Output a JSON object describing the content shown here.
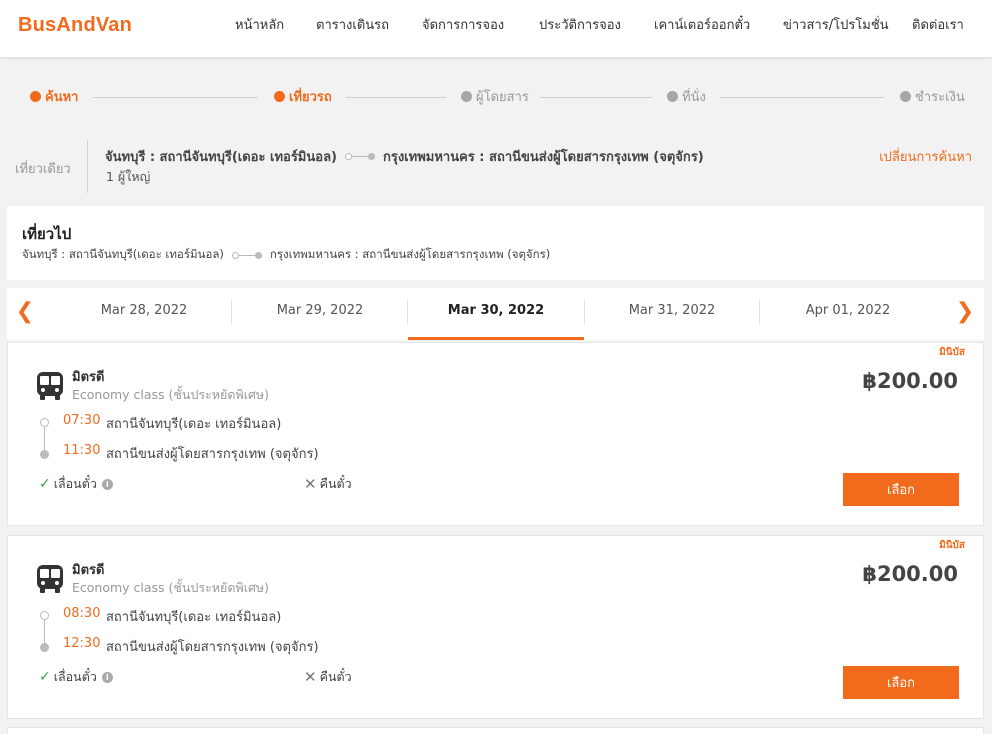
{
  "header": {
    "logo": "BusAndVan",
    "nav": [
      "หน้าหลัก",
      "ตารางเดินรถ",
      "จัดการการจอง",
      "ประวัติการจอง",
      "เคาน์เตอร์ออกตั๋ว",
      "ข่าวสาร/โปรโมชั่น",
      "ติดต่อเรา"
    ]
  },
  "stepper": {
    "steps": [
      "ค้นหา",
      "เที่ยวรถ",
      "ผู้โดยสาร",
      "ที่นั่ง",
      "ชำระเงิน"
    ],
    "active_color": "#f26b1d"
  },
  "search": {
    "trip_type": "เที่ยวเดียว",
    "origin": "จันทบุรี : สถานีจันทบุรี(เดอะ เทอร์มินอล)",
    "destination": "กรุงเทพมหานคร : สถานีขนส่งผู้โดยสารกรุงเทพ (จตุจักร)",
    "passengers": "1 ผู้ใหญ่",
    "change_label": "เปลี่ยนการค้นหา"
  },
  "outbound": {
    "title": "เที่ยวไป",
    "origin": "จันทบุรี : สถานีจันทบุรี(เดอะ เทอร์มินอล)",
    "destination": "กรุงเทพมหานคร : สถานีขนส่งผู้โดยสารกรุงเทพ (จตุจักร)"
  },
  "dates": {
    "tabs": [
      "Mar 28, 2022",
      "Mar 29, 2022",
      "Mar 30, 2022",
      "Mar 31, 2022",
      "Apr 01, 2022"
    ],
    "selected": "Mar 30, 2022"
  },
  "trips": [
    {
      "badge": "มินิบัส",
      "operator": "มิตรดี",
      "class": "Economy class (ชั้นประหยัดพิเศษ)",
      "depart_time": "07:30",
      "depart_station": "สถานีจันทบุรี(เดอะ เทอร์มินอล)",
      "arrive_time": "11:30",
      "arrive_station": "สถานีขนส่งผู้โดยสารกรุงเทพ (จตุจักร)",
      "price": "฿200.00",
      "postpone": "เลื่อนตั๋ว",
      "refund": "คืนตั๋ว",
      "select_label": "เลือก"
    },
    {
      "badge": "มินิบัส",
      "operator": "มิตรดี",
      "class": "Economy class (ชั้นประหยัดพิเศษ)",
      "depart_time": "08:30",
      "depart_station": "สถานีจันทบุรี(เดอะ เทอร์มินอล)",
      "arrive_time": "12:30",
      "arrive_station": "สถานีขนส่งผู้โดยสารกรุงเทพ (จตุจักร)",
      "price": "฿200.00",
      "postpone": "เลื่อนตั๋ว",
      "refund": "คืนตั๋ว",
      "select_label": "เลือก"
    }
  ]
}
